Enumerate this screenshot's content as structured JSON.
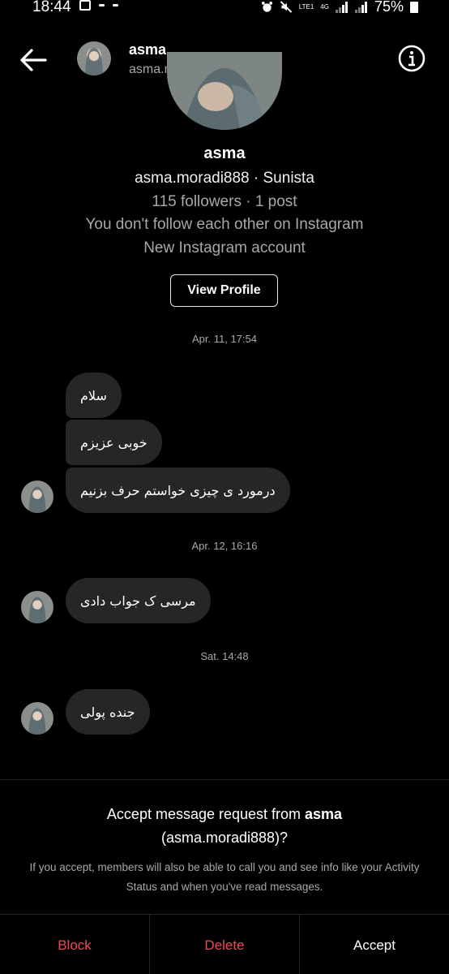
{
  "status_bar": {
    "time": "18:44",
    "network_label": "LTE1",
    "data_label": "4G",
    "battery": "75%"
  },
  "header": {
    "name": "asma",
    "username": "asma.moradi888"
  },
  "profile": {
    "name": "asma",
    "meta": "asma.moradi888 · Sunista",
    "stats": "115 followers · 1 post",
    "follow_note": "You don't follow each other on Instagram",
    "account_note": "New Instagram account",
    "view_profile_label": "View Profile"
  },
  "conversation": [
    {
      "timestamp": "Apr. 11, 17:54",
      "messages": [
        "سلام",
        "خوبی عزیزم",
        "درمورد ی چیزی خواستم حرف بزنیم"
      ]
    },
    {
      "timestamp": "Apr. 12, 16:16",
      "messages": [
        "مرسی ک جواب دادی"
      ]
    },
    {
      "timestamp": "Sat. 14:48",
      "messages": [
        "جنده پولی"
      ]
    }
  ],
  "request": {
    "title_prefix": "Accept message request from ",
    "title_name": "asma",
    "title_username": "(asma.moradi888)",
    "title_suffix": "?",
    "note": "If you accept, members will also be able to call you and see info like your Activity Status and when you've read messages.",
    "block_label": "Block",
    "delete_label": "Delete",
    "accept_label": "Accept"
  },
  "colors": {
    "background": "#000000",
    "bubble": "#262626",
    "secondary_text": "#a8a8a8",
    "danger": "#ed4956"
  },
  "icons": [
    "back-arrow-icon",
    "info-icon",
    "gallery-icon",
    "alarm-icon",
    "mute-icon",
    "signal-icon",
    "battery-icon"
  ]
}
